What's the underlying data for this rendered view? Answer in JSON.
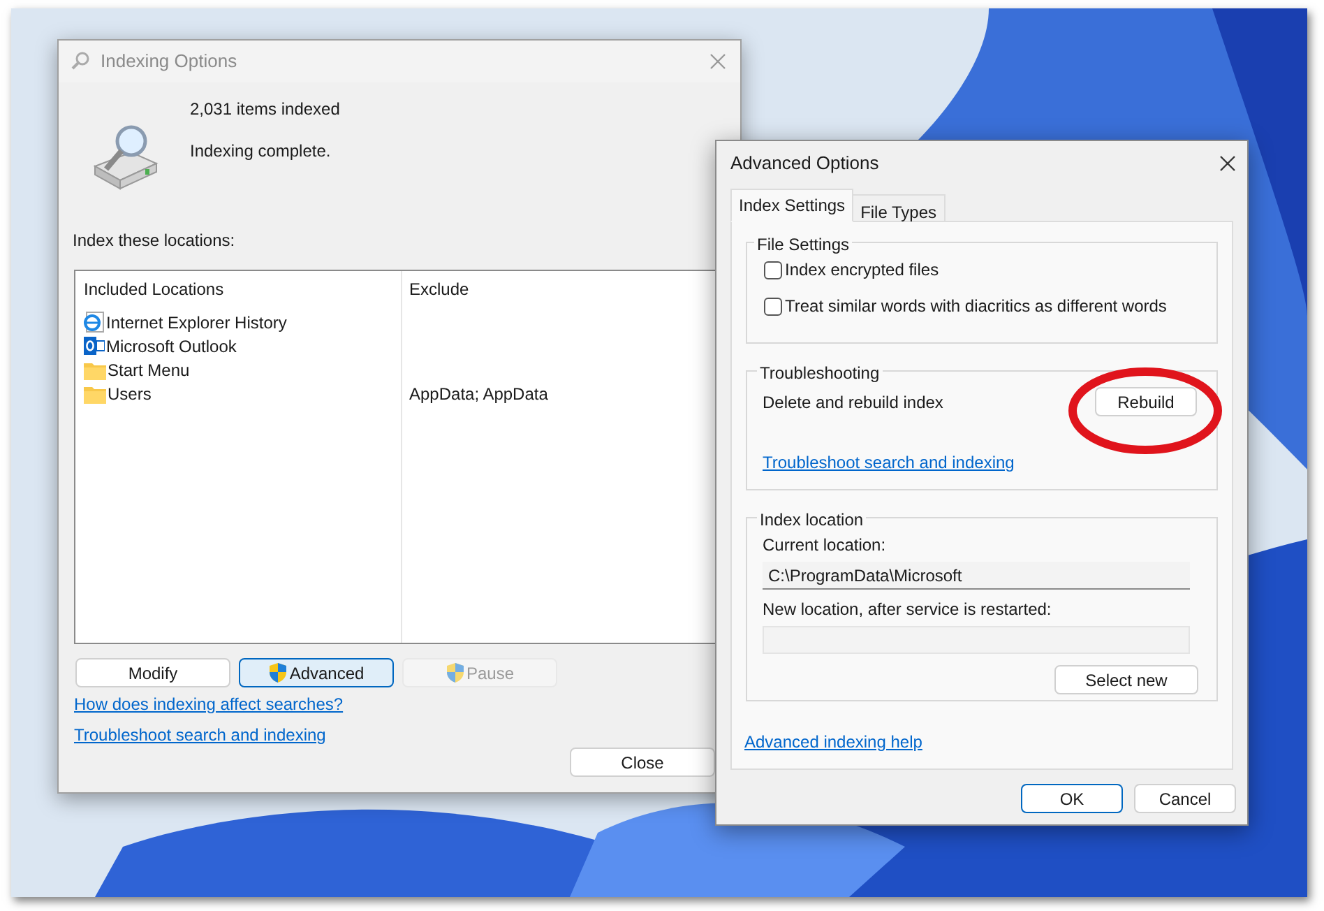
{
  "indexing_options": {
    "title": "Indexing Options",
    "items_indexed": "2,031 items indexed",
    "status": "Indexing complete.",
    "locations_label": "Index these locations:",
    "columns": [
      "Included Locations",
      "Exclude"
    ],
    "rows": [
      {
        "kind": "history",
        "location": "Internet Explorer History"
      },
      {
        "kind": "outlook",
        "location": "Microsoft Outlook"
      },
      {
        "kind": "folder",
        "location": "Start Menu"
      },
      {
        "kind": "folder",
        "location": "Users",
        "exclude": "AppData; AppData"
      }
    ],
    "buttons": [
      {
        "label": "Modify",
        "shield": false,
        "focused": false,
        "disabled": false
      },
      {
        "label": "Advanced",
        "shield": true,
        "focused": true,
        "disabled": false
      },
      {
        "label": "Pause",
        "shield": true,
        "focused": false,
        "disabled": true
      }
    ],
    "links": [
      "How does indexing affect searches?",
      "Troubleshoot search and indexing"
    ],
    "close_button": "Close"
  },
  "advanced_options": {
    "title": "Advanced Options",
    "tabs": [
      {
        "label": "Index Settings",
        "selected": true
      },
      {
        "label": "File Types",
        "selected": false
      }
    ],
    "file_settings": {
      "title": "File Settings",
      "options": [
        {
          "label": "Index encrypted files",
          "checked": false
        },
        {
          "label": "Treat similar words with diacritics as different words",
          "checked": false
        }
      ]
    },
    "troubleshooting": {
      "title": "Troubleshooting",
      "text": "Delete and rebuild index",
      "button": "Rebuild",
      "highlighted": true,
      "link": "Troubleshoot search and indexing"
    },
    "index_location": {
      "title": "Index location",
      "current_label": "Current location:",
      "current_value": "C:\\ProgramData\\Microsoft",
      "new_label": "New location, after service is restarted:",
      "button": "Select new"
    },
    "help_link": "Advanced indexing help",
    "buttons": [
      {
        "label": "OK",
        "default": true
      },
      {
        "label": "Cancel",
        "default": false
      }
    ]
  }
}
